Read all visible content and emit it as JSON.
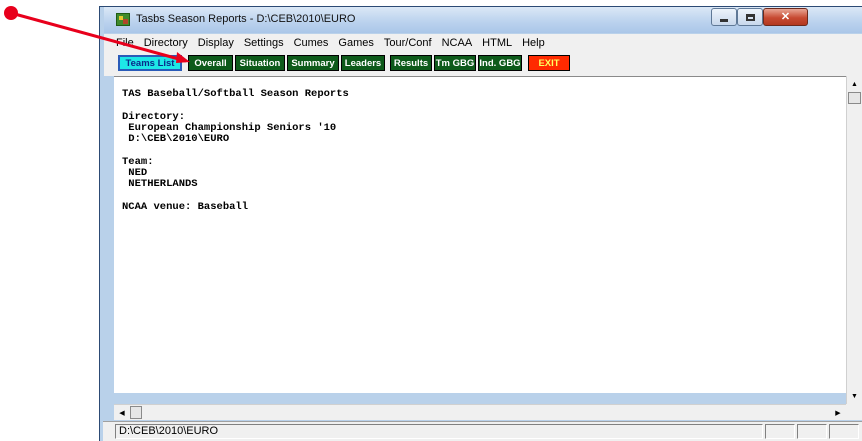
{
  "window": {
    "title": "Tasbs Season Reports - D:\\CEB\\2010\\EURO"
  },
  "menu": [
    "File",
    "Directory",
    "Display",
    "Settings",
    "Cumes",
    "Games",
    "Tour/Conf",
    "NCAA",
    "HTML",
    "Help"
  ],
  "toolbar": {
    "teams_list": "Teams List",
    "overall": "Overall",
    "situation": "Situation",
    "summary": "Summary",
    "leaders": "Leaders",
    "results": "Results",
    "tm_gbg": "Tm GBG",
    "ind_gbg": "Ind. GBG",
    "exit": "EXIT"
  },
  "report": {
    "heading": "TAS Baseball/Softball Season Reports",
    "directory_label": "Directory:",
    "directory_name": " European Championship Seniors '10",
    "directory_path": " D:\\CEB\\2010\\EURO",
    "team_label": "Team:",
    "team_code": " NED",
    "team_name": " NETHERLANDS",
    "ncaa_venue": "NCAA venue: Baseball"
  },
  "status": {
    "path": "D:\\CEB\\2010\\EURO"
  },
  "colors": {
    "annotation": "#e8001c",
    "button_green": "#0d5a1a",
    "button_active": "#1de7e7",
    "button_exit": "#ff2a00"
  }
}
